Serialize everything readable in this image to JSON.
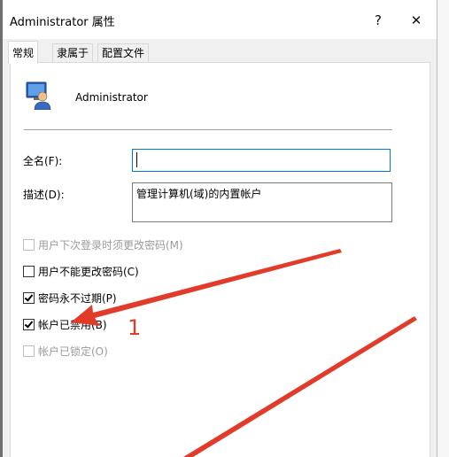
{
  "window": {
    "title": "Administrator 属性",
    "help_glyph": "?",
    "close_glyph": "✕"
  },
  "tabs": [
    {
      "label": "常规",
      "active": true
    },
    {
      "label": "隶属于",
      "active": false
    },
    {
      "label": "配置文件",
      "active": false
    }
  ],
  "user": {
    "icon": "user-account-icon",
    "name": "Administrator"
  },
  "form": {
    "fullname_label": "全名(F):",
    "fullname_value": "",
    "description_label": "描述(D):",
    "description_value": "管理计算机(域)的内置帐户"
  },
  "options": [
    {
      "label": "用户下次登录时须更改密码(M)",
      "checked": false,
      "enabled": false
    },
    {
      "label": "用户不能更改密码(C)",
      "checked": false,
      "enabled": true
    },
    {
      "label": "密码永不过期(P)",
      "checked": true,
      "enabled": true
    },
    {
      "label": "帐户已禁用(B)",
      "checked": true,
      "enabled": true
    },
    {
      "label": "帐户已锁定(O)",
      "checked": false,
      "enabled": false
    }
  ],
  "annotation": {
    "number": "1",
    "color": "#e23b2a"
  }
}
